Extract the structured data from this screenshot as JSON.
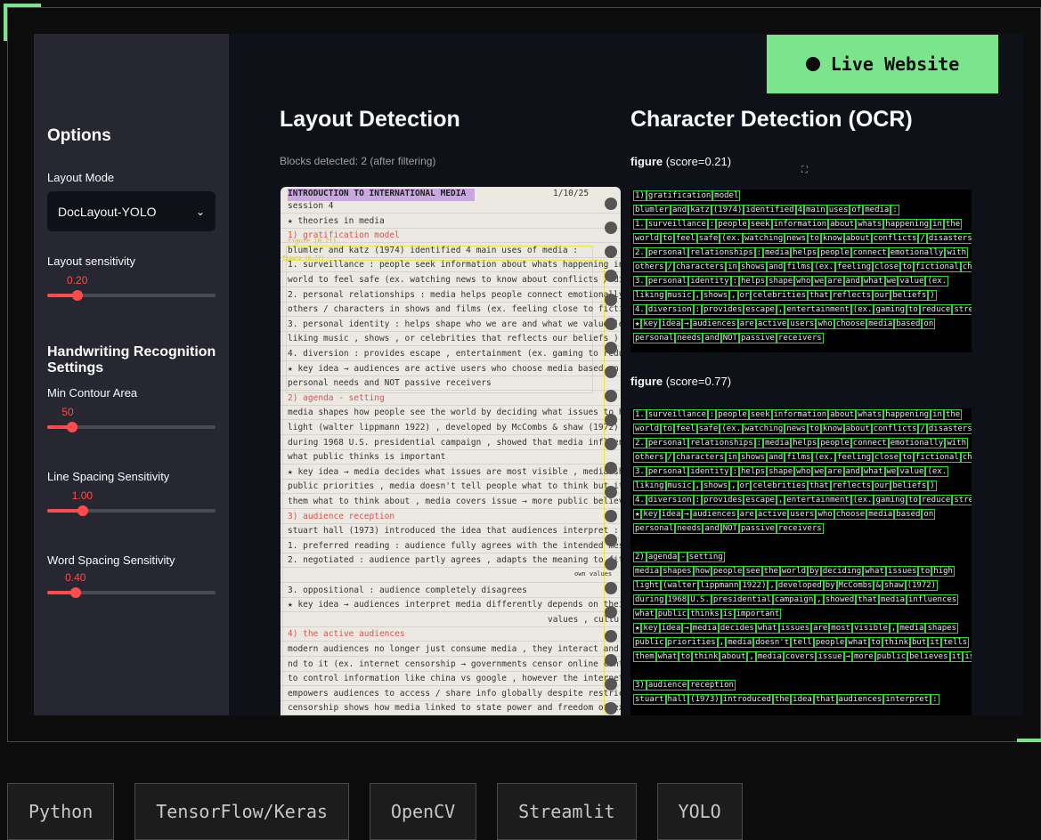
{
  "sidebar": {
    "title": "Options",
    "layout_mode_label": "Layout Mode",
    "layout_mode_value": "DocLayout-YOLO",
    "layout_sensitivity_label": "Layout sensitivity",
    "layout_sensitivity_value": "0.20",
    "layout_sensitivity_fraction": 0.18,
    "handwriting_title": "Handwriting Recognition Settings",
    "min_contour_label": "Min Contour Area",
    "min_contour_value": "50",
    "min_contour_fraction": 0.15,
    "line_spacing_label": "Line Spacing Sensitivity",
    "line_spacing_value": "1.00",
    "line_spacing_fraction": 0.21,
    "word_spacing_label": "Word Spacing Sensitivity",
    "word_spacing_value": "0.40",
    "word_spacing_fraction": 0.17
  },
  "main": {
    "layout_title": "Layout Detection",
    "blocks_caption": "Blocks detected: 2 (after filtering)",
    "ocr_title": "Character Detection (OCR)",
    "figures": [
      {
        "kind": "figure",
        "score": "(score=0.21)"
      },
      {
        "kind": "figure",
        "score": "(score=0.77)"
      }
    ],
    "notebook": {
      "header": "INTRODUCTION TO INTERNATIONAL MEDIA",
      "date": "1/10/25",
      "box_label_1": "figure (0.21)",
      "box_label_2": "figure (0.77)",
      "lines": [
        "session 4",
        "★ theories in media",
        "1) gratification model",
        "blumler and katz (1974) identified 4 main uses of media :",
        "1. surveillance : people seek information about whats happening in the",
        "world to feel safe (ex. watching news to know about conflicts / disasters",
        "2. personal relationships : media helps people connect emotionally with",
        "others / characters in shows and films (ex. feeling close to fictional ch",
        "3. personal identity : helps shape who we are and what we value (ex.",
        "liking music , shows , or celebrities that reflects our beliefs )",
        "4. diversion : provides escape , entertainment (ex. gaming to reduce stress",
        "★ key idea → audiences are active users who choose media based on",
        "personal needs and NOT passive receivers",
        "2) agenda - setting",
        "media shapes how people see the world by deciding what issues to high",
        "light (walter lippmann 1922) , developed by McCombs & shaw (1972)",
        "during 1968 U.S. presidential campaign , showed that media influences",
        "what public thinks is important",
        "★ key idea → media decides what issues are most visible , media shapes",
        "public priorities , media doesn't tell people what to think but it tells",
        "them what to think about , media covers issue → more public believes it is",
        "3) audience reception",
        "stuart hall (1973) introduced the idea that audiences interpret :",
        "1. preferred reading : audience fully agrees with the intended message",
        "2. negotiated : audience partly agrees , adapts the meaning to fit their",
        "own values",
        "3. oppositional : audience completely disagrees",
        "★ key idea → audiences interpret media differently depends on their own",
        "values , cultu",
        "4) the active audiences",
        "modern audiences no longer just consume media , they interact and respo",
        "nd to it (ex. internet censorship → governments censor online content",
        "to control information like china vs google , however the internet",
        "empowers audiences to access / share info globally despite restrictions.",
        "censorship shows how media linked to state power and freedom of expressio"
      ]
    },
    "ocr_top_lines": [
      "1) gratification model",
      "blumler and katz (1974) identified 4 main uses of media :",
      "1. surveillance : people seek information about whats happening in the",
      "world to feel safe (ex. watching news to know about conflicts / disasters",
      "2. personal relationships : media helps people connect emotionally with",
      "others / characters in shows and films (ex. feeling close to fictional ch",
      "3. personal identity : helps shape who we are and what we value (ex.",
      "liking music , shows , or celebrities that reflects our beliefs )",
      "4. diversion : provides escape , entertainment (ex. gaming to reduce stress",
      "★ key idea → audiences are active users who choose media based on",
      "personal needs and NOT passive receivers"
    ],
    "ocr_bottom_lines": [
      "1. surveillance : people seek information about whats happening in the",
      "world to feel safe (ex. watching news to know about conflicts / disasters",
      "2. personal relationships : media helps people connect emotionally with",
      "others / characters in shows and films (ex. feeling close to fictional ch",
      "3. personal identity : helps shape who we are and what we value (ex.",
      "liking music , shows , or celebrities that reflects our beliefs )",
      "4. diversion : provides escape , entertainment (ex. gaming to reduce stress",
      "★ key idea → audiences are active users who choose media based on",
      "personal needs and NOT passive receivers",
      "",
      "2) agenda - setting",
      "media shapes how people see the world by deciding what issues to high",
      "light (walter lippmann 1922) , developed by McCombs & shaw (1972)",
      "during 1968 U.S. presidential campaign , showed that media influences",
      "what public thinks is important",
      "★ key idea → media decides what issues are most visible , media shapes",
      "public priorities , media doesn't tell people what to think but it tells",
      "them what to think about , media covers issue → more public believes it is",
      "",
      "3) audience reception",
      "stuart hall (1973) introduced the idea that audiences interpret :"
    ]
  },
  "badge": {
    "label": "Live Website"
  },
  "tags": [
    "Python",
    "TensorFlow/Keras",
    "OpenCV",
    "Streamlit",
    "YOLO"
  ],
  "colors": {
    "accent": "#7be58e",
    "slider": "#ff4b4b",
    "ocr_box": "#38d43c",
    "yolo_box": "#e8e44a"
  }
}
